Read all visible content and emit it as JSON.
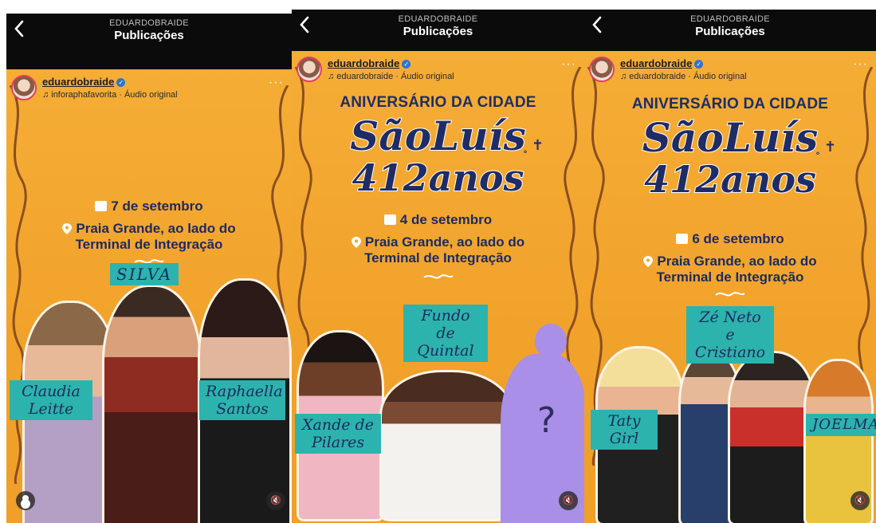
{
  "posts": [
    {
      "header": {
        "account": "EDUARDOBRAIDE",
        "title": "Publicações"
      },
      "user": {
        "username": "eduardobraide",
        "audio": "inforaphafavorita · Áudio original"
      },
      "poster": {
        "date": "7 de setembro",
        "location_line1": "Praia Grande, ao lado do",
        "location_line2": "Terminal de Integração",
        "artists": [
          "SILVA",
          "Claudia Leitte",
          "Raphaella Santos"
        ]
      }
    },
    {
      "header": {
        "account": "EDUARDOBRAIDE",
        "title": "Publicações"
      },
      "user": {
        "username": "eduardobraide",
        "audio": "eduardobraide · Áudio original"
      },
      "poster": {
        "heading": "ANIVERSÁRIO DA CIDADE",
        "logo_line1": "SãoLuís",
        "logo_line2": "412anos",
        "date": "4 de setembro",
        "location_line1": "Praia Grande, ao lado do",
        "location_line2": "Terminal de Integração",
        "artists": [
          "Fundo de Quintal",
          "Xande de Pilares"
        ],
        "mystery": "?"
      }
    },
    {
      "header": {
        "account": "EDUARDOBRAIDE",
        "title": "Publicações"
      },
      "user": {
        "username": "eduardobraide",
        "audio": "eduardobraide · Áudio original"
      },
      "poster": {
        "heading": "ANIVERSÁRIO DA CIDADE",
        "logo_line1": "SãoLuís",
        "logo_line2": "412anos",
        "date": "6 de setembro",
        "location_line1": "Praia Grande, ao lado do",
        "location_line2": "Terminal de Integração",
        "artists": [
          "Zé Neto e Cristiano",
          "Taty Girl",
          "JOELMA"
        ]
      }
    }
  ],
  "colors": {
    "poster_bg": "#f2a52e",
    "navy": "#1e2d67",
    "teal_tag": "#2cb3ad",
    "silhouette": "#a98fe8"
  },
  "icons": {
    "back": "chevron-left-icon",
    "verified": "verified-badge-icon",
    "audio": "music-note-icon",
    "more": "more-dots-icon",
    "mute": "speaker-muted-icon",
    "tags": "user-tag-icon"
  }
}
